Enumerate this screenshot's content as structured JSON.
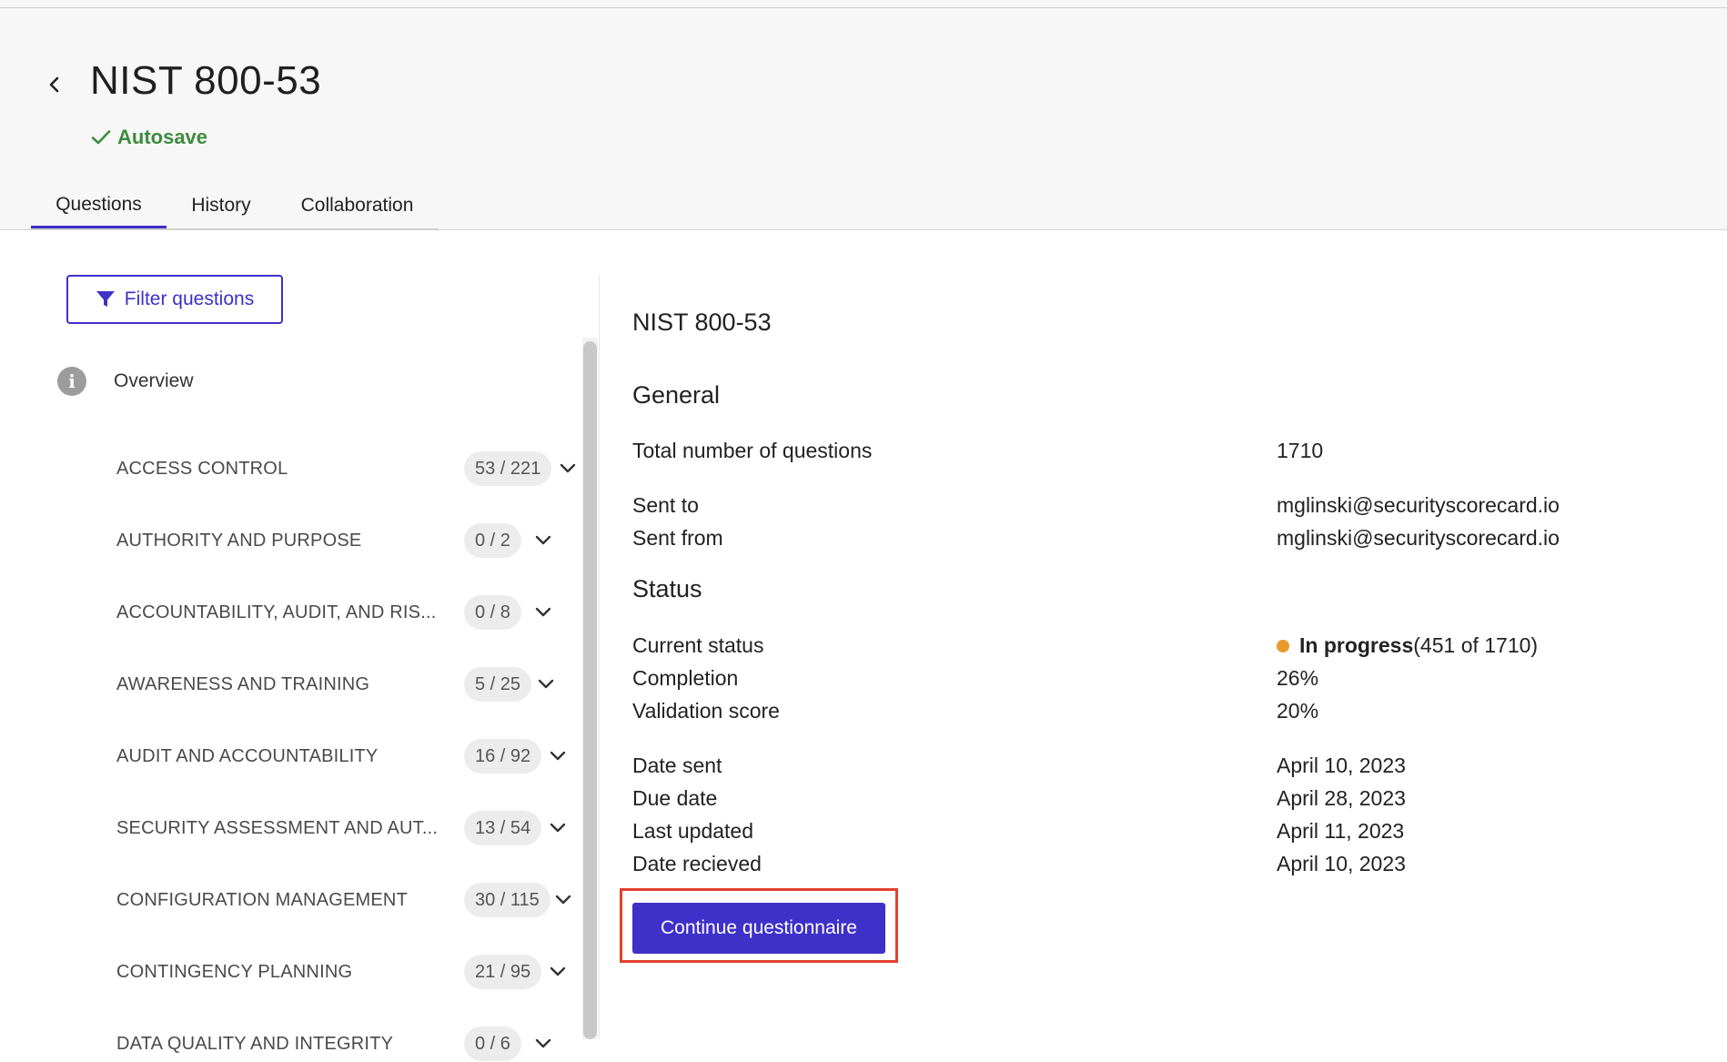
{
  "header": {
    "title": "NIST 800-53",
    "autosave_label": "Autosave",
    "tabs": [
      {
        "label": "Questions",
        "active": true
      },
      {
        "label": "History",
        "active": false
      },
      {
        "label": "Collaboration",
        "active": false
      }
    ]
  },
  "sidebar": {
    "filter_label": "Filter questions",
    "overview_label": "Overview",
    "sections": [
      {
        "name": "ACCESS CONTROL",
        "count": "53 / 221"
      },
      {
        "name": "AUTHORITY AND PURPOSE",
        "count": "0 / 2"
      },
      {
        "name": "ACCOUNTABILITY, AUDIT, AND RIS...",
        "count": "0 / 8"
      },
      {
        "name": "AWARENESS AND TRAINING",
        "count": "5 / 25"
      },
      {
        "name": "AUDIT AND ACCOUNTABILITY",
        "count": "16 / 92"
      },
      {
        "name": "SECURITY ASSESSMENT AND AUT...",
        "count": "13 / 54"
      },
      {
        "name": "CONFIGURATION MANAGEMENT",
        "count": "30 / 115"
      },
      {
        "name": "CONTINGENCY PLANNING",
        "count": "21 / 95"
      },
      {
        "name": "DATA QUALITY AND INTEGRITY",
        "count": "0 / 6"
      }
    ]
  },
  "detail": {
    "title": "NIST 800-53",
    "general_heading": "General",
    "total_label": "Total number of questions",
    "total_value": "1710",
    "sent_to_label": "Sent to",
    "sent_to_value": "mglinski@securityscorecard.io",
    "sent_from_label": "Sent from",
    "sent_from_value": "mglinski@securityscorecard.io",
    "status_heading": "Status",
    "current_status_label": "Current status",
    "current_status_value": "In progress",
    "current_status_detail": "(451 of 1710)",
    "status_color": "#e89a2b",
    "completion_label": "Completion",
    "completion_value": "26%",
    "validation_label": "Validation score",
    "validation_value": "20%",
    "date_sent_label": "Date sent",
    "date_sent_value": "April 10, 2023",
    "due_date_label": "Due date",
    "due_date_value": "April 28, 2023",
    "last_updated_label": "Last updated",
    "last_updated_value": "April 11, 2023",
    "date_received_label": "Date recieved",
    "date_received_value": "April 10, 2023",
    "continue_label": "Continue questionnaire"
  },
  "colors": {
    "accent": "#3f30c9",
    "success": "#3e8b3e",
    "highlight": "#e2412b"
  }
}
